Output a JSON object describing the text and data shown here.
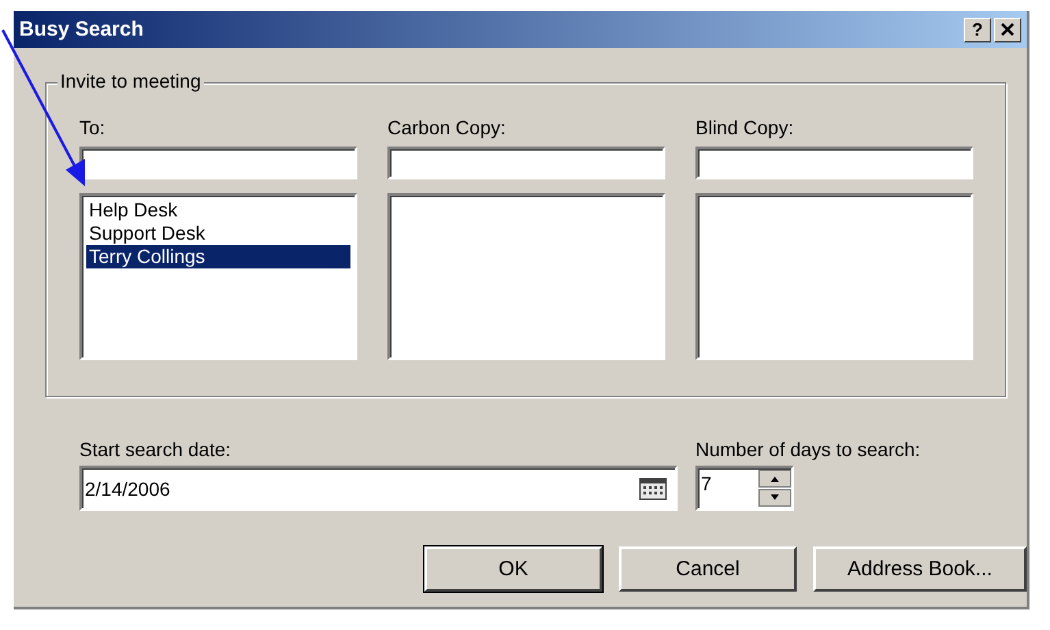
{
  "window": {
    "title": "Busy Search",
    "help": "?"
  },
  "group": {
    "title": "Invite to meeting",
    "columns": [
      {
        "label": "To:",
        "items": [
          {
            "text": "Help Desk",
            "selected": false
          },
          {
            "text": "Support Desk",
            "selected": false
          },
          {
            "text": "Terry Collings",
            "selected": true
          }
        ]
      },
      {
        "label": "Carbon Copy:"
      },
      {
        "label": "Blind Copy:"
      }
    ]
  },
  "start_date": {
    "label": "Start search date:",
    "value": "2/14/2006"
  },
  "days": {
    "label": "Number of days to search:",
    "value": "7"
  },
  "buttons": [
    {
      "label": "OK",
      "default": true
    },
    {
      "label": "Cancel",
      "default": false
    },
    {
      "label": "Address Book...",
      "default": false
    }
  ]
}
